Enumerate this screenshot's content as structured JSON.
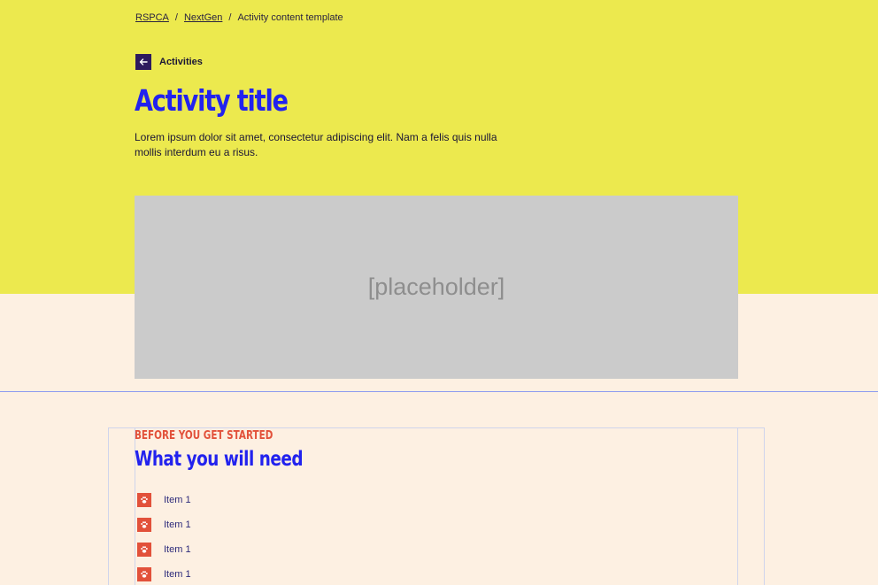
{
  "breadcrumb": {
    "items": [
      "RSPCA",
      "NextGen"
    ],
    "current": "Activity content template",
    "separator": "/"
  },
  "back_link": {
    "label": "Activities",
    "icon": "arrow-left-icon"
  },
  "hero": {
    "title": "Activity title",
    "intro": "Lorem ipsum dolor sit amet, consectetur adipiscing elit. Nam a felis quis nulla mollis interdum eu a risus.",
    "image_placeholder": "[placeholder]"
  },
  "section": {
    "eyebrow": "BEFORE YOU GET STARTED",
    "heading": "What you will need",
    "items": [
      "Item 1",
      "Item 1",
      "Item 1",
      "Item 1"
    ],
    "item_icon": "paw-icon"
  },
  "colors": {
    "hero_background": "#ece94e",
    "page_background": "#fdf0e2",
    "title_blue": "#2222ee",
    "accent_red": "#e2513a",
    "dark_purple": "#2d1a5e"
  }
}
